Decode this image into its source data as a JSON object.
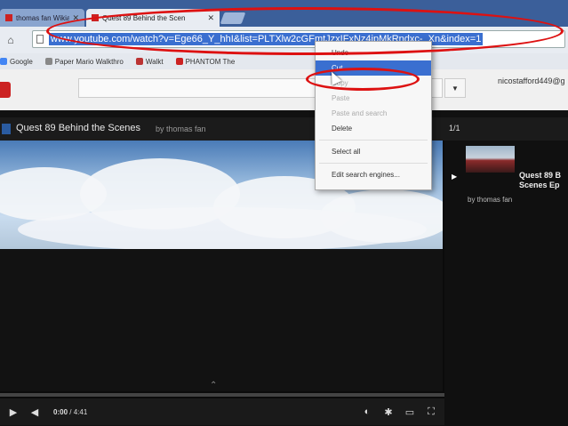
{
  "browser": {
    "tabs": [
      {
        "label": "thomas fan Wikia Q",
        "active": false
      },
      {
        "label": "Quest 89 Behind the Scen",
        "active": true
      }
    ],
    "url": "www.youtube.com/watch?v=Ege66_Y_hhI&list=PLTXlw2cGFmtJzxIFxNz4ipMkRndxc-_Xn&index=1",
    "bookmarks": [
      "Google",
      "Paper Mario Walkthro",
      "Walkt",
      "PHANTOM The"
    ]
  },
  "context_menu": {
    "items": [
      {
        "label": "Undo",
        "state": "normal"
      },
      {
        "label": "Cut",
        "state": "highlighted"
      },
      {
        "label": "Copy",
        "state": "dim"
      },
      {
        "label": "Paste",
        "state": "dim"
      },
      {
        "label": "Paste and search",
        "state": "dim"
      },
      {
        "label": "Delete",
        "state": "normal"
      },
      {
        "label": "Select all",
        "state": "normal"
      },
      {
        "label": "Edit search engines...",
        "state": "normal"
      }
    ]
  },
  "youtube": {
    "user": "nicostafford449@g",
    "search_button": "▼",
    "playlist": {
      "title": "Quest 89 Behind the Scenes",
      "by": "by thomas fan",
      "count": "1/1"
    },
    "player": {
      "current_time": "0:00",
      "duration": "/ 4:41",
      "progress": 0
    },
    "sidebar_video": {
      "title": "Quest 89 B Scenes Ep",
      "by": "by thomas fan"
    }
  },
  "colors": {
    "annotation": "#dd1111",
    "highlight": "#3a6fd0"
  }
}
